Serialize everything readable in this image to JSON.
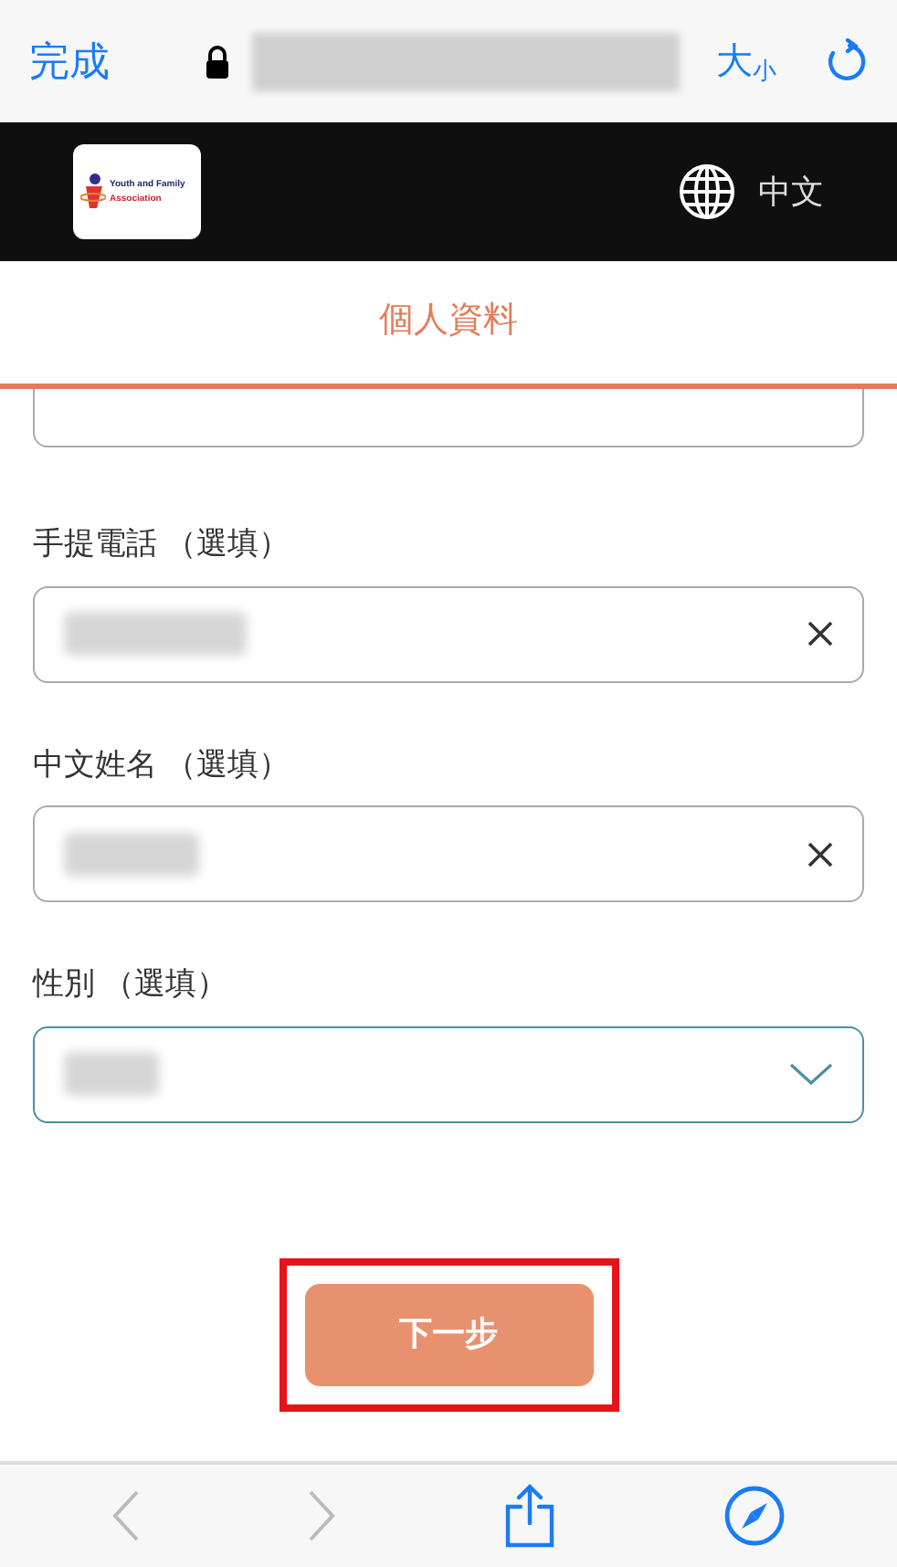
{
  "browser": {
    "done": "完成",
    "text_size": "大",
    "text_size_small": "小",
    "url_blurred": true
  },
  "header": {
    "logo_line_1": "Youth and Family",
    "logo_line_2": "Association",
    "language": "中文"
  },
  "tabs": [
    {
      "label": "個人資料",
      "selected": true
    }
  ],
  "fields": [
    {
      "kind": "partial"
    },
    {
      "kind": "text",
      "label": "手提電話 （選填）",
      "focused": false
    },
    {
      "kind": "text",
      "label": "中文姓名 （選填）",
      "focused": false
    },
    {
      "kind": "select",
      "label": "性別 （選填）",
      "focused": true
    }
  ],
  "next_button": {
    "label": "下一步",
    "highlighted": true
  },
  "toolbar": {
    "back_disabled": true,
    "forward_disabled": true
  }
}
